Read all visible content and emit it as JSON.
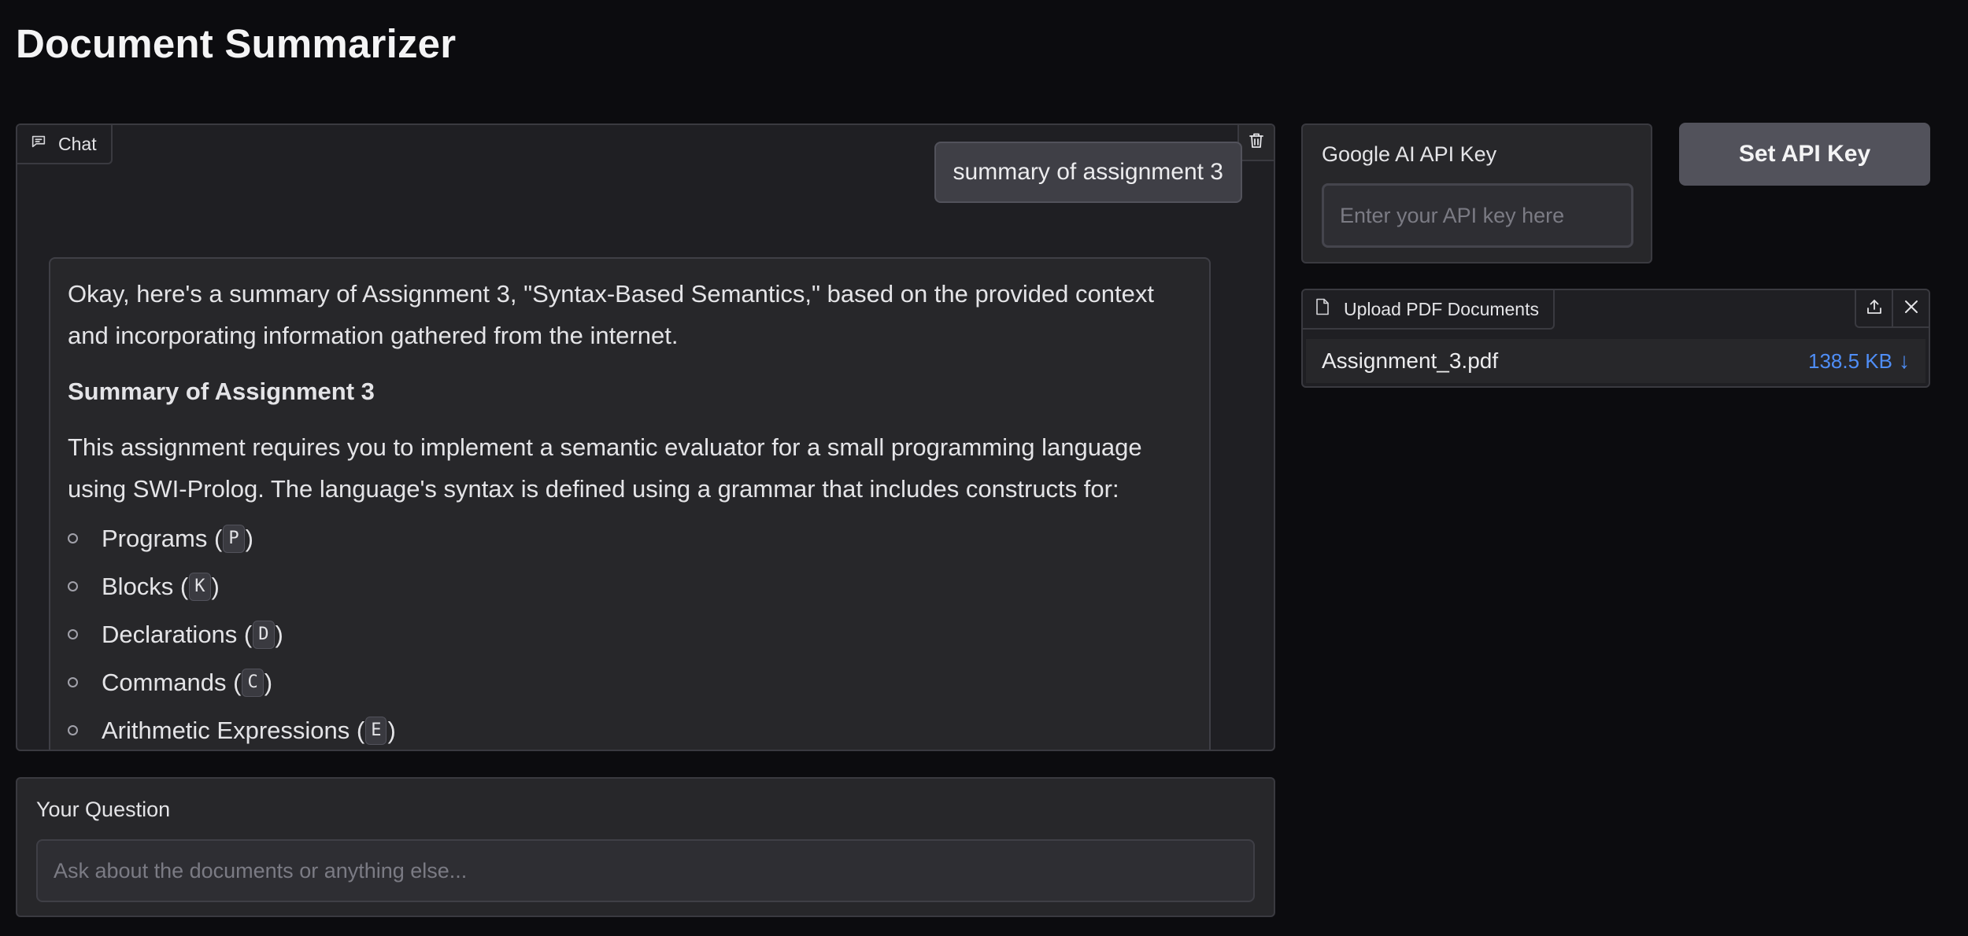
{
  "page": {
    "title": "Document Summarizer"
  },
  "chat": {
    "tab_label": "Chat",
    "tab_icon": "chat-bubble-icon",
    "clear_icon": "trash-icon",
    "user_message": "summary of assignment 3",
    "bot_message": {
      "intro": "Okay, here's a summary of Assignment 3, \"Syntax-Based Semantics,\" based on the provided context and incorporating information gathered from the internet.",
      "heading": "Summary of Assignment 3",
      "description": "This assignment requires you to implement a semantic evaluator for a small programming language using SWI-Prolog. The language's syntax is defined using a grammar that includes constructs for:",
      "constructs": [
        {
          "label": "Programs (",
          "symbol": "P",
          "close": ")"
        },
        {
          "label": "Blocks (",
          "symbol": "K",
          "close": ")"
        },
        {
          "label": "Declarations (",
          "symbol": "D",
          "close": ")"
        },
        {
          "label": "Commands (",
          "symbol": "C",
          "close": ")"
        },
        {
          "label": "Arithmetic Expressions (",
          "symbol": "E",
          "close": ")"
        }
      ]
    }
  },
  "question": {
    "label": "Your Question",
    "placeholder": "Ask about the documents or anything else..."
  },
  "api_key": {
    "label": "Google AI API Key",
    "placeholder": "Enter your API key here",
    "button_label": "Set API Key"
  },
  "upload": {
    "tab_label": "Upload PDF Documents",
    "tab_icon": "file-icon",
    "upload_icon": "upload-icon",
    "close_icon": "close-icon",
    "file": {
      "name": "Assignment_3.pdf",
      "size": "138.5 KB",
      "download_icon": "↓"
    }
  },
  "colors": {
    "background": "#0c0c0f",
    "panel": "#27272a",
    "accent_link": "#4f8ef7",
    "button": "#52525b"
  }
}
